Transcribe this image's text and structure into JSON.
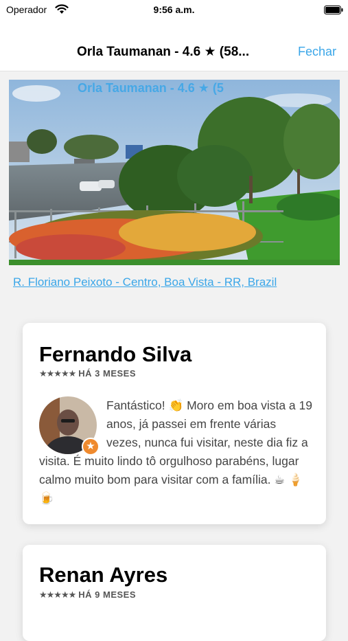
{
  "status_bar": {
    "carrier": "Operador",
    "time": "9:56 a.m."
  },
  "nav": {
    "title": "Orla Taumanan - 4.6 ★ (58...",
    "close_label": "Fechar"
  },
  "hero": {
    "overlay_title": "Orla Taumanan - 4.6 ★ (5"
  },
  "address": "R. Floriano Peixoto - Centro, Boa Vista - RR, Brazil",
  "reviews": [
    {
      "author": "Fernando Silva",
      "stars": "★★★★★",
      "rating": 5,
      "time_ago": "HÁ 3 MESES",
      "text": "Fantástico! 👏 Moro em boa vista a 19 anos, já passei em frente várias vezes, nunca fui visitar, neste dia fiz a visita. É muito lindo tô orgulhoso parabéns, lugar calmo muito bom para visitar com a família. ☕ 🍦 🍺"
    },
    {
      "author": "Renan Ayres",
      "stars": "★★★★★",
      "rating": 5,
      "time_ago": "HÁ 9 MESES"
    }
  ],
  "colors": {
    "accent": "#3aa6e8",
    "badge": "#ef8a2e"
  },
  "icons": {
    "wifi": "wifi-icon",
    "battery": "battery-icon",
    "badge": "star-badge-icon"
  }
}
